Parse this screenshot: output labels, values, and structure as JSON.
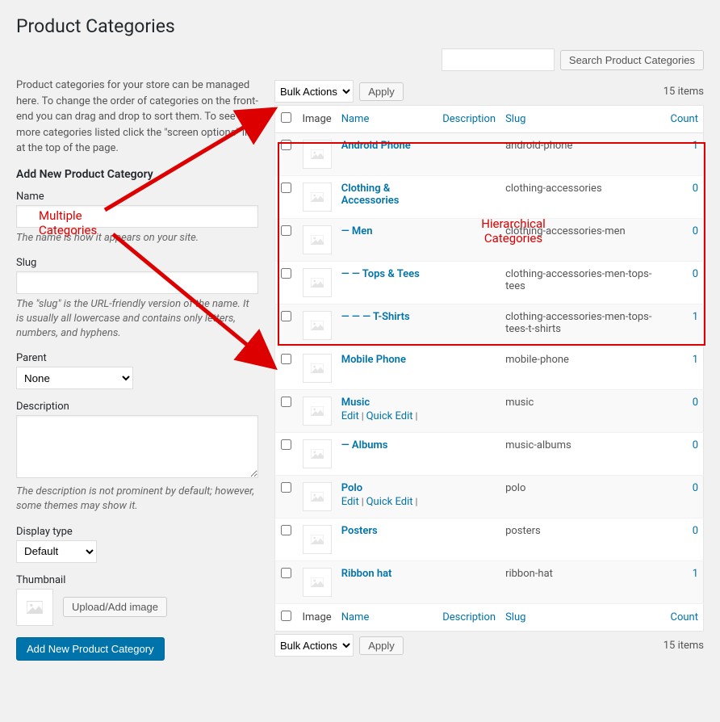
{
  "page_title": "Product Categories",
  "search_button": "Search Product Categories",
  "intro_text": "Product categories for your store can be managed here. To change the order of categories on the front-end you can drag and drop to sort them. To see more categories listed click the \"screen options\" link at the top of the page.",
  "form": {
    "heading": "Add New Product Category",
    "name_label": "Name",
    "name_desc": "The name is how it appears on your site.",
    "slug_label": "Slug",
    "slug_desc": "The \"slug\" is the URL-friendly version of the name. It is usually all lowercase and contains only letters, numbers, and hyphens.",
    "parent_label": "Parent",
    "parent_value": "None",
    "desc_label": "Description",
    "desc_desc": "The description is not prominent by default; however, some themes may show it.",
    "display_label": "Display type",
    "display_value": "Default",
    "thumb_label": "Thumbnail",
    "upload_button": "Upload/Add image",
    "submit_button": "Add New Product Category"
  },
  "bulk": {
    "label": "Bulk Actions",
    "apply": "Apply"
  },
  "items_count": "15 items",
  "columns": {
    "image": "Image",
    "name": "Name",
    "description": "Description",
    "slug": "Slug",
    "count": "Count"
  },
  "row_actions": {
    "edit": "Edit",
    "quick_edit": "Quick Edit"
  },
  "rows": [
    {
      "name": "Android Phone",
      "slug": "android-phone",
      "count": "1",
      "actions": false
    },
    {
      "name": "Clothing & Accessories",
      "slug": "clothing-accessories",
      "count": "0",
      "actions": false
    },
    {
      "name": "— Men",
      "slug": "clothing-accessories-men",
      "count": "0",
      "actions": false
    },
    {
      "name": "— — Tops & Tees",
      "slug": "clothing-accessories-men-tops-tees",
      "count": "0",
      "actions": false
    },
    {
      "name": "— — — T-Shirts",
      "slug": "clothing-accessories-men-tops-tees-t-shirts",
      "count": "1",
      "actions": false
    },
    {
      "name": "Mobile Phone",
      "slug": "mobile-phone",
      "count": "1",
      "actions": false
    },
    {
      "name": "Music",
      "slug": "music",
      "count": "0",
      "actions": true
    },
    {
      "name": "— Albums",
      "slug": "music-albums",
      "count": "0",
      "actions": false
    },
    {
      "name": "Polo",
      "slug": "polo",
      "count": "0",
      "actions": true
    },
    {
      "name": "Posters",
      "slug": "posters",
      "count": "0",
      "actions": false
    },
    {
      "name": "Ribbon hat",
      "slug": "ribbon-hat",
      "count": "1",
      "actions": false
    }
  ],
  "annotations": {
    "multiple": "Multiple Categories",
    "hierarchical": "Hierarchical Categories"
  }
}
